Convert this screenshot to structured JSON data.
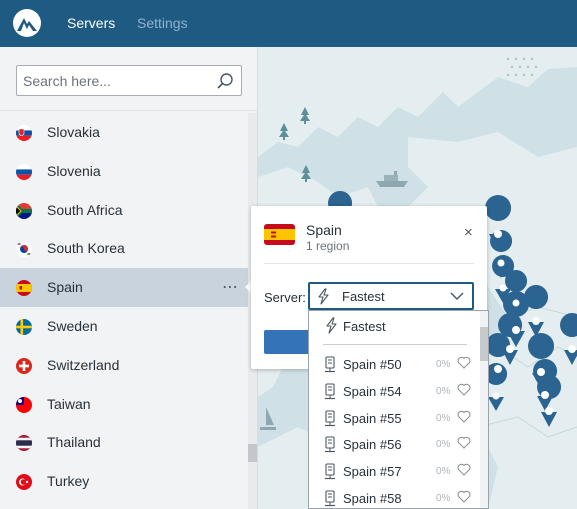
{
  "topbar": {
    "logo_icon": "nordvpn-mountain-logo",
    "tabs": [
      {
        "label": "Servers",
        "active": true
      },
      {
        "label": "Settings",
        "active": false
      }
    ]
  },
  "search": {
    "placeholder": "Search here...",
    "value": "",
    "icon": "search-icon"
  },
  "countries": [
    {
      "label": "Slovakia",
      "flag": "slovakia-flag-icon"
    },
    {
      "label": "Slovenia",
      "flag": "slovenia-flag-icon"
    },
    {
      "label": "South Africa",
      "flag": "south-africa-flag-icon"
    },
    {
      "label": "South Korea",
      "flag": "south-korea-flag-icon"
    },
    {
      "label": "Spain",
      "flag": "spain-flag-icon",
      "selected": true,
      "menu": "⋯"
    },
    {
      "label": "Sweden",
      "flag": "sweden-flag-icon"
    },
    {
      "label": "Switzerland",
      "flag": "switzerland-flag-icon"
    },
    {
      "label": "Taiwan",
      "flag": "taiwan-flag-icon"
    },
    {
      "label": "Thailand",
      "flag": "thailand-flag-icon"
    },
    {
      "label": "Turkey",
      "flag": "turkey-flag-icon"
    }
  ],
  "popup": {
    "title": "Spain",
    "subtitle": "1 region",
    "close": "×",
    "server_label": "Server:",
    "selected_server": "Fastest"
  },
  "dropdown": {
    "fastest_label": "Fastest",
    "servers": [
      {
        "label": "Spain #50",
        "load": "0%"
      },
      {
        "label": "Spain #54",
        "load": "0%"
      },
      {
        "label": "Spain #55",
        "load": "0%"
      },
      {
        "label": "Spain #56",
        "load": "0%"
      },
      {
        "label": "Spain #57",
        "load": "0%"
      },
      {
        "label": "Spain #58",
        "load": "0%"
      }
    ]
  },
  "colors": {
    "topbar": "#1e5a82",
    "accent": "#3473b8",
    "map_water": "#cfe1e7",
    "map_land": "#e4eef0",
    "pin": "#2b6490",
    "selected_row": "#c8d3dd"
  }
}
